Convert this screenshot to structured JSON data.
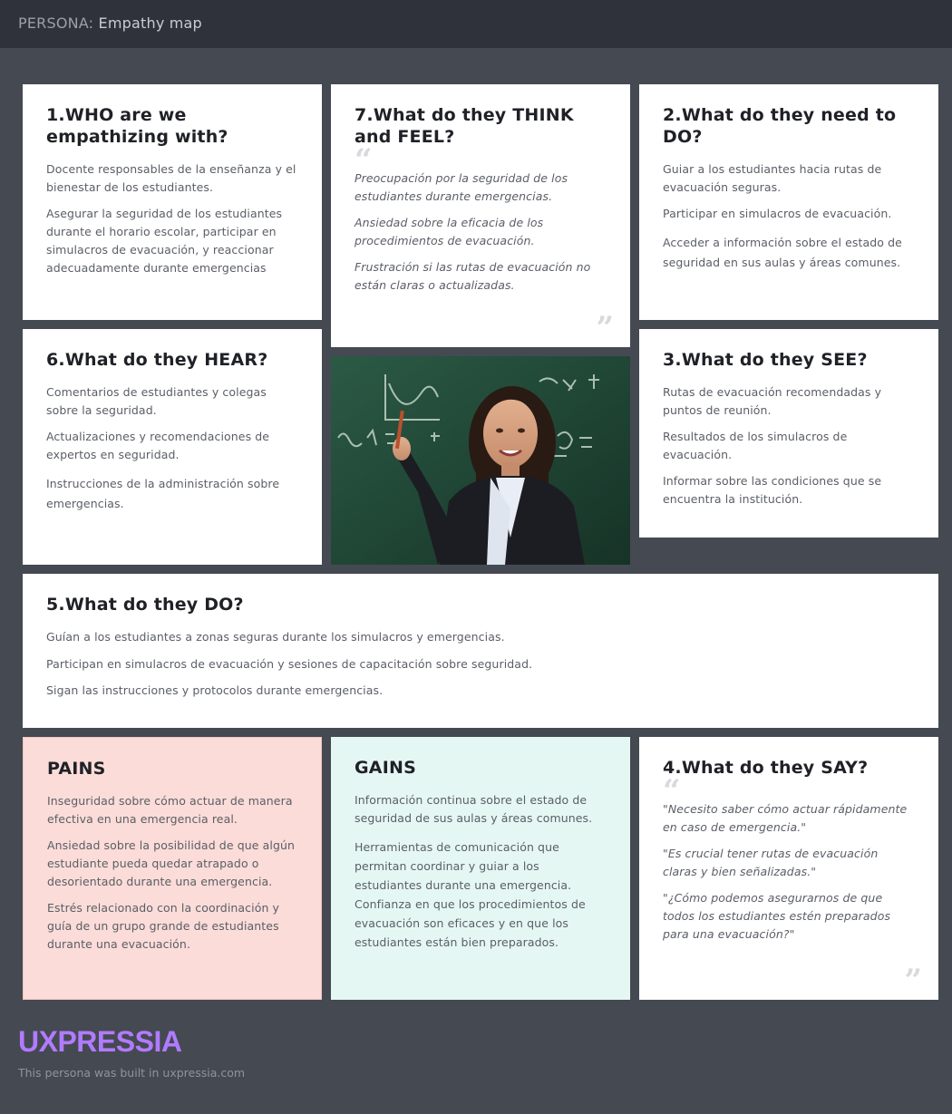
{
  "header": {
    "prefix": "PERSONA:",
    "title": "Empathy map"
  },
  "who": {
    "heading": "1.WHO are we empathizing with?",
    "items": [
      "Docente responsables de la enseñanza y el bienestar de los estudiantes.",
      "Asegurar la seguridad de los estudiantes durante el horario escolar, participar en simulacros de evacuación, y reaccionar adecuadamente durante emergencias"
    ]
  },
  "think": {
    "heading": "7.What do they THINK and FEEL?",
    "items": [
      "Preocupación por la seguridad de los estudiantes durante emergencias.",
      "Ansiedad sobre la eficacia de los procedimientos de evacuación.",
      "Frustración si las rutas de evacuación no están claras o actualizadas."
    ]
  },
  "need": {
    "heading": "2.What do they need to DO?",
    "items": [
      "Guiar a los estudiantes hacia rutas de evacuación seguras.",
      "Participar en simulacros de evacuación.",
      "Acceder a información sobre el estado de seguridad en sus aulas y áreas comunes."
    ]
  },
  "hear": {
    "heading": "6.What do they HEAR?",
    "items": [
      "Comentarios de estudiantes y colegas sobre la seguridad.",
      "Actualizaciones y recomendaciones de expertos en seguridad.",
      "Instrucciones de la administración sobre emergencias."
    ]
  },
  "see": {
    "heading": "3.What do they SEE?",
    "items": [
      "Rutas de evacuación recomendadas y puntos de reunión.",
      "Resultados de los simulacros de evacuación.",
      "Informar sobre las condiciones que se encuentra la institución."
    ]
  },
  "do": {
    "heading": "5.What do they DO?",
    "items": [
      "Guían a los estudiantes a zonas seguras durante los simulacros y emergencias.",
      "Participan en simulacros de evacuación y sesiones de capacitación sobre seguridad.",
      "Sigan las instrucciones y protocolos durante emergencias."
    ]
  },
  "pains": {
    "heading": "PAINS",
    "items": [
      "Inseguridad sobre cómo actuar de manera efectiva en una emergencia real.",
      "Ansiedad sobre la posibilidad de que algún estudiante pueda quedar atrapado o desorientado durante una emergencia.",
      "Estrés relacionado con la coordinación y guía de un grupo grande de estudiantes durante una evacuación."
    ]
  },
  "gains": {
    "heading": "GAINS",
    "items": [
      "Información continua sobre el estado de seguridad de sus aulas y áreas comunes.",
      "Herramientas de comunicación que permitan coordinar y guiar a los estudiantes durante una emergencia. Confianza en que los procedimientos de evacuación son eficaces y en que los estudiantes están bien preparados."
    ]
  },
  "say": {
    "heading": "4.What do they SAY?",
    "items": [
      "\"Necesito saber cómo actuar rápidamente en caso de emergencia.\"",
      "\"Es crucial tener rutas de evacuación claras y bien señalizadas.\"",
      "\"¿Cómo podemos asegurarnos de que todos los estudiantes estén preparados para una evacuación?\""
    ]
  },
  "footer": {
    "logo": "UXPRESSIA",
    "note": "This persona was built in uxpressia.com"
  },
  "colors": {
    "background": "#454952",
    "topbar": "#2f323a",
    "pains": "#fbdcd8",
    "gains": "#e5f7f3",
    "logo": "#b17bff"
  },
  "icons": [
    "open-quote-icon",
    "close-quote-icon",
    "persona-photo"
  ]
}
